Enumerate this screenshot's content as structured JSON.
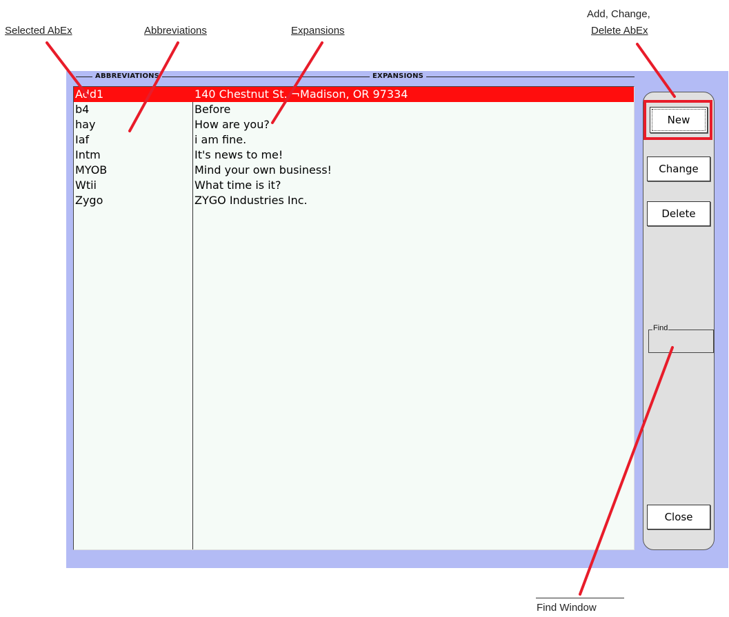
{
  "callouts": {
    "selected": "Selected AbEx",
    "abbreviations": "Abbreviations",
    "expansions": "Expansions",
    "add_change_line1": "Add, Change,",
    "add_change_line2": "Delete AbEx",
    "find_window": "Find Window"
  },
  "headers": {
    "abbreviations": "ABBREVIATIONS",
    "expansions": "EXPANSIONS"
  },
  "rows": [
    {
      "abbr": "Add1",
      "exp": "140 Chestnut St. ¬Madison,  OR 97334",
      "selected": true
    },
    {
      "abbr": "b4",
      "exp": "Before"
    },
    {
      "abbr": "hay",
      "exp": "How are you?"
    },
    {
      "abbr": "Iaf",
      "exp": "i am fine."
    },
    {
      "abbr": "Intm",
      "exp": "It's news to me!"
    },
    {
      "abbr": "MYOB",
      "exp": "Mind your own business!"
    },
    {
      "abbr": "Wtii",
      "exp": "What time is it?"
    },
    {
      "abbr": "Zygo",
      "exp": "ZYGO Industries Inc."
    }
  ],
  "buttons": {
    "new": "New",
    "change": "Change",
    "delete": "Delete",
    "close": "Close"
  },
  "find": {
    "label": "Find",
    "value": ""
  },
  "colors": {
    "background": "#b3bbf5",
    "selection": "#ff0d0d",
    "callout_line": "#e81c2a",
    "list_bg": "#f5fbf7",
    "panel_bg": "#e0e0e0"
  }
}
